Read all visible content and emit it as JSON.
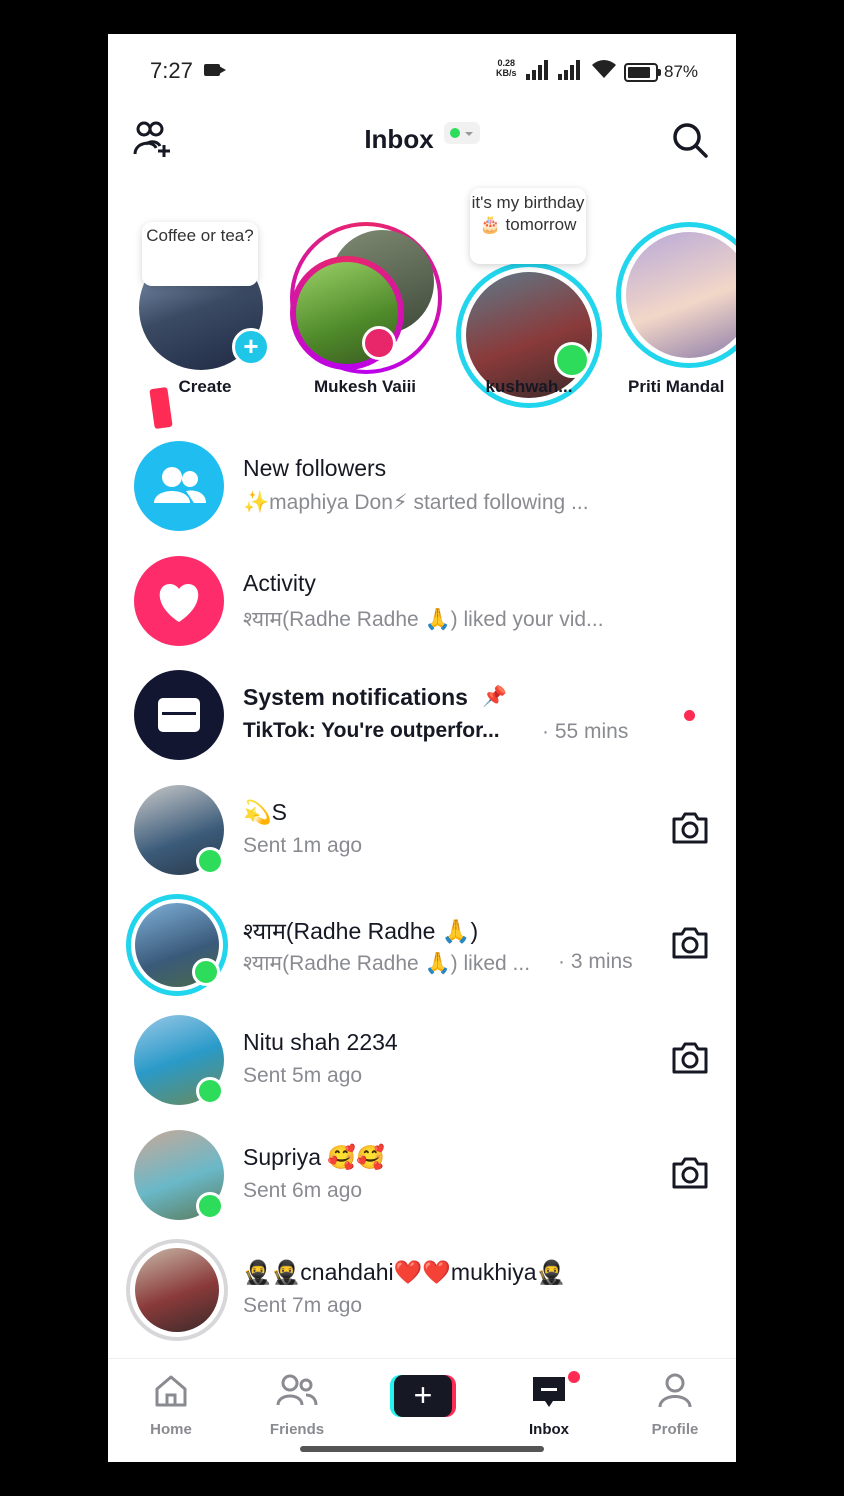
{
  "status_bar": {
    "time": "7:27",
    "net_speed_value": "0.28",
    "net_speed_unit": "KB/s",
    "battery": "87%"
  },
  "header": {
    "title": "Inbox",
    "online_status_color": "#2ddc5a",
    "left_icon": "add-friends-icon",
    "right_icon": "search-icon"
  },
  "stories": [
    {
      "name": "Create",
      "bubble": "Coffee or tea?"
    },
    {
      "name": "Mukesh Vaiii"
    },
    {
      "name": "kushwah...",
      "bubble": "it's my birthday🎂 tomorrow"
    },
    {
      "name": "Priti Mandal"
    }
  ],
  "system_rows": [
    {
      "title": "New followers",
      "subtitle": "✨maphiya Don⚡ started following ...",
      "icon": "followers-icon",
      "color": "#20bdf0"
    },
    {
      "title": "Activity",
      "subtitle": "श्याम(Radhe Radhe 🙏) liked your vid...",
      "icon": "heart-icon",
      "color": "#fe2c6b"
    },
    {
      "title": "System notifications",
      "subtitle": "TikTok: You're outperfor...",
      "time": "· 55 mins",
      "icon": "inbox-tray-icon",
      "color": "#121631"
    }
  ],
  "chats": [
    {
      "name": "💫S",
      "subtitle": "Sent 1m ago",
      "time": ""
    },
    {
      "name": "श्याम(Radhe Radhe 🙏)",
      "subtitle": "श्याम(Radhe Radhe 🙏) liked ...",
      "time": "· 3 mins"
    },
    {
      "name": "Nitu shah 2234",
      "subtitle": "Sent 5m ago",
      "time": ""
    },
    {
      "name": "Supriya 🥰🥰",
      "subtitle": "Sent 6m ago",
      "time": ""
    },
    {
      "name": "🥷🥷cnahdahi❤️❤️mukhiya🥷",
      "subtitle": "Sent 7m ago",
      "time": ""
    }
  ],
  "nav": {
    "home": "Home",
    "friends": "Friends",
    "inbox": "Inbox",
    "profile": "Profile",
    "accent": "#fe2c55"
  }
}
